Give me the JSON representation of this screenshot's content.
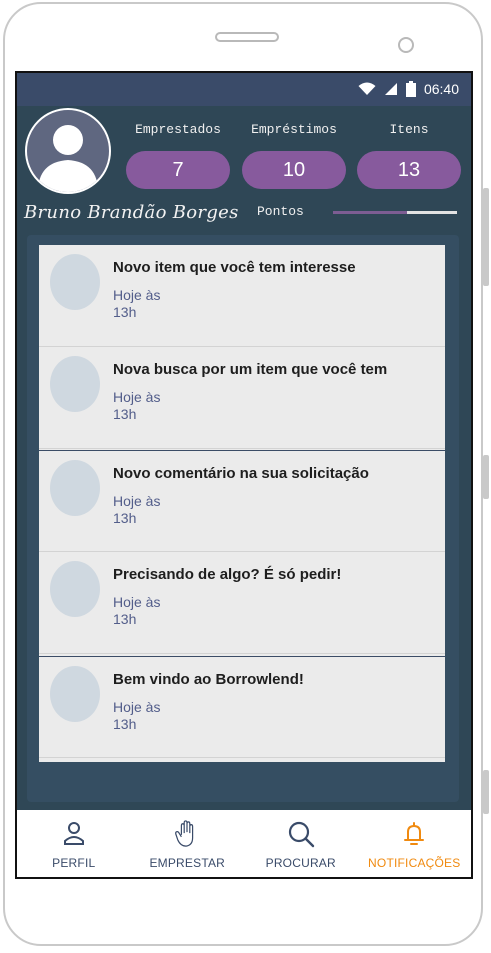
{
  "status_bar": {
    "time": "06:40",
    "icons": [
      "wifi-icon",
      "signal-icon",
      "battery-icon"
    ]
  },
  "profile": {
    "user_name": "Bruno Brandão Borges",
    "avatar_icon": "user-avatar-icon",
    "stats": [
      {
        "label": "Emprestados",
        "value": "7"
      },
      {
        "label": "Empréstimos",
        "value": "10"
      },
      {
        "label": "Itens",
        "value": "13"
      }
    ],
    "points": {
      "label": "Pontos",
      "progress": 0.8
    }
  },
  "notifications": [
    {
      "title": "Novo item que você tem interesse",
      "time_line1": "Hoje às",
      "time_line2": "13h"
    },
    {
      "title": "Nova busca por um item que você tem",
      "time_line1": "Hoje às",
      "time_line2": "13h"
    },
    {
      "title": "Novo comentário na sua solicitação",
      "time_line1": "Hoje às",
      "time_line2": "13h"
    },
    {
      "title": "Precisando de algo? É só pedir!",
      "time_line1": "Hoje às",
      "time_line2": "13h"
    },
    {
      "title": "Bem vindo ao Borrowlend!",
      "time_line1": "Hoje às",
      "time_line2": "13h"
    }
  ],
  "nav": [
    {
      "label": "PERFIL",
      "icon": "person-icon"
    },
    {
      "label": "EMPRESTAR",
      "icon": "hand-icon"
    },
    {
      "label": "PROCURAR",
      "icon": "search-icon"
    },
    {
      "label": "NOTIFICAÇÕES",
      "icon": "bell-icon",
      "active": true
    }
  ],
  "colors": {
    "accent": "#875a9d",
    "active_nav": "#f08a10",
    "header": "#2f4756",
    "status_bar": "#3a4b69"
  }
}
